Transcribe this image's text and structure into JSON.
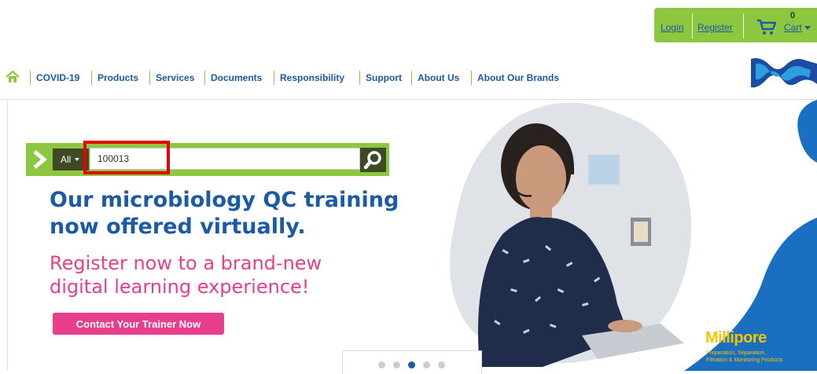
{
  "account": {
    "login": "Login",
    "register": "Register",
    "cart_count": "0",
    "cart_label": "Cart"
  },
  "nav": {
    "items": [
      "COVID-19",
      "Products",
      "Services",
      "Documents",
      "Responsibility",
      "Support",
      "About Us",
      "About Our Brands"
    ]
  },
  "search": {
    "scope": "All",
    "value": "100013"
  },
  "banner": {
    "headline_line1": "Our microbiology QC training",
    "headline_line2": "now offered virtually.",
    "subline_line1": "Register now to a brand-new",
    "subline_line2": "digital learning experience!",
    "cta": "Contact Your Trainer Now",
    "brand_name": "Millipore",
    "brand_tagline_line1": "Preparation, Separation,",
    "brand_tagline_line2": "Filtration & Monitoring Products"
  },
  "carousel": {
    "slide_count": 5,
    "active_slide": 3
  },
  "colors": {
    "accent_green": "#8dc63f",
    "link_blue": "#1a5aa6",
    "pink": "#e83e8c",
    "dark_green": "#3d4a24",
    "highlight_red": "#e60000",
    "brand_yellow": "#f4c400"
  }
}
